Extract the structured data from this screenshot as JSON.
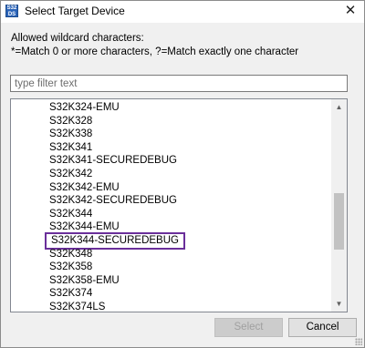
{
  "window": {
    "title": "Select Target Device",
    "icon_text": "S32\nDS",
    "close_glyph": "✕"
  },
  "description": {
    "line1": "Allowed wildcard characters:",
    "line2": "*=Match 0 or more characters, ?=Match exactly one character"
  },
  "filter": {
    "placeholder": "type filter text",
    "value": ""
  },
  "list": {
    "items": [
      "S32K324-EMU",
      "S32K328",
      "S32K338",
      "S32K341",
      "S32K341-SECUREDEBUG",
      "S32K342",
      "S32K342-EMU",
      "S32K342-SECUREDEBUG",
      "S32K344",
      "S32K344-EMU",
      "S32K344-SECUREDEBUG",
      "S32K348",
      "S32K358",
      "S32K358-EMU",
      "S32K374",
      "S32K374LS"
    ],
    "highlighted_index": 10,
    "highlight_color": "#6a2f9a"
  },
  "buttons": {
    "select_label": "Select",
    "cancel_label": "Cancel"
  }
}
